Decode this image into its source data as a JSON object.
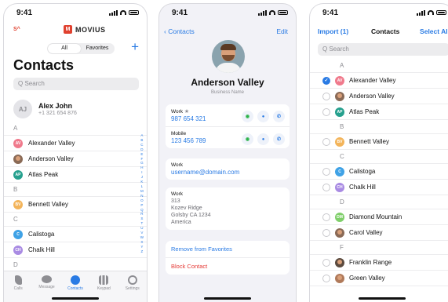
{
  "colors": {
    "accent": "#2a7be4",
    "brand": "#e0412f",
    "danger": "#e53935",
    "whatsapp": "#2bb34a"
  },
  "status": {
    "time": "9:41"
  },
  "screen1": {
    "brand_mark": "S^",
    "logo_icon": "movius-logo-icon",
    "logo_text": "MOVIUS",
    "segments": [
      "All",
      "Favorites"
    ],
    "add_icon": "+",
    "title": "Contacts",
    "search_placeholder": "Search",
    "me": {
      "initials": "AJ",
      "name": "Alex John",
      "phone": "+1 321 654 876"
    },
    "sections": [
      {
        "letter": "A",
        "contacts": [
          {
            "initials": "AV",
            "name": "Alexander Valley",
            "color": "#f07a8c",
            "photo": false
          },
          {
            "initials": "",
            "name": "Anderson Valley",
            "color": "#8a6a56",
            "photo": true
          },
          {
            "initials": "AP",
            "name": "Atlas Peak",
            "color": "#26a08e",
            "photo": false
          }
        ]
      },
      {
        "letter": "B",
        "contacts": [
          {
            "initials": "BV",
            "name": "Bennett Valley",
            "color": "#f3b45a",
            "photo": false
          }
        ]
      },
      {
        "letter": "C",
        "contacts": [
          {
            "initials": "C",
            "name": "Calistoga",
            "color": "#3fa2e6",
            "photo": false
          },
          {
            "initials": "CH",
            "name": "Chalk Hill",
            "color": "#a98be3",
            "photo": false
          }
        ]
      },
      {
        "letter": "D",
        "contacts": []
      }
    ],
    "alphabet": [
      "A",
      "B",
      "C",
      "D",
      "E",
      "F",
      "G",
      "H",
      "I",
      "J",
      "K",
      "L",
      "M",
      "N",
      "O",
      "P",
      "Q",
      "R",
      "S",
      "T",
      "U",
      "V",
      "W",
      "X",
      "Y",
      "Z"
    ],
    "tabs": [
      {
        "label": "Calls",
        "icon": "phone-icon",
        "active": false
      },
      {
        "label": "Message",
        "icon": "message-icon",
        "active": false
      },
      {
        "label": "Contacts",
        "icon": "contacts-icon",
        "active": true
      },
      {
        "label": "Keypad",
        "icon": "keypad-icon",
        "active": false
      },
      {
        "label": "Settings",
        "icon": "settings-icon",
        "active": false
      }
    ]
  },
  "screen2": {
    "back_label": "Contacts",
    "edit_label": "Edit",
    "name": "Anderson Valley",
    "business": "Business Name",
    "phones": [
      {
        "label": "Work",
        "favorite": true,
        "value": "987 654 321"
      },
      {
        "label": "Mobile",
        "favorite": false,
        "value": "123 456 789"
      }
    ],
    "email": {
      "label": "Work",
      "value": "username@domain.com"
    },
    "address": {
      "label": "Work",
      "lines": [
        "313",
        "Kozev Ridge",
        "Golsby CA 1234",
        "America"
      ]
    },
    "remove_favorites": "Remove from Favorites",
    "block_contact": "Block Contact"
  },
  "screen3": {
    "import_label": "Import (1)",
    "title": "Contacts",
    "select_all": "Select All",
    "search_placeholder": "Search",
    "sections": [
      {
        "letter": "A",
        "contacts": [
          {
            "initials": "AV",
            "name": "Alexander Valley",
            "color": "#f07a8c",
            "photo": false,
            "checked": true
          },
          {
            "initials": "",
            "name": "Anderson Valley",
            "color": "#8a6a56",
            "photo": true,
            "checked": false
          },
          {
            "initials": "AP",
            "name": "Atlas Peak",
            "color": "#26a08e",
            "photo": false,
            "checked": false
          }
        ]
      },
      {
        "letter": "B",
        "contacts": [
          {
            "initials": "BV",
            "name": "Bennett Valley",
            "color": "#f3b45a",
            "photo": false,
            "checked": false
          }
        ]
      },
      {
        "letter": "C",
        "contacts": [
          {
            "initials": "C",
            "name": "Calistoga",
            "color": "#3fa2e6",
            "photo": false,
            "checked": false
          },
          {
            "initials": "CH",
            "name": "Chalk Hill",
            "color": "#a98be3",
            "photo": false,
            "checked": false
          }
        ]
      },
      {
        "letter": "D",
        "contacts": [
          {
            "initials": "DM",
            "name": "Diamond Mountain",
            "color": "#7fcf6a",
            "photo": false,
            "checked": false
          },
          {
            "initials": "",
            "name": "Carol Valley",
            "color": "#8a6a56",
            "photo": true,
            "checked": false
          }
        ]
      },
      {
        "letter": "F",
        "contacts": [
          {
            "initials": "",
            "name": "Franklin Range",
            "color": "#5b4a3e",
            "photo": true,
            "checked": false
          },
          {
            "initials": "",
            "name": "Green Valley",
            "color": "#b07a5a",
            "photo": true,
            "checked": false
          }
        ]
      }
    ]
  }
}
